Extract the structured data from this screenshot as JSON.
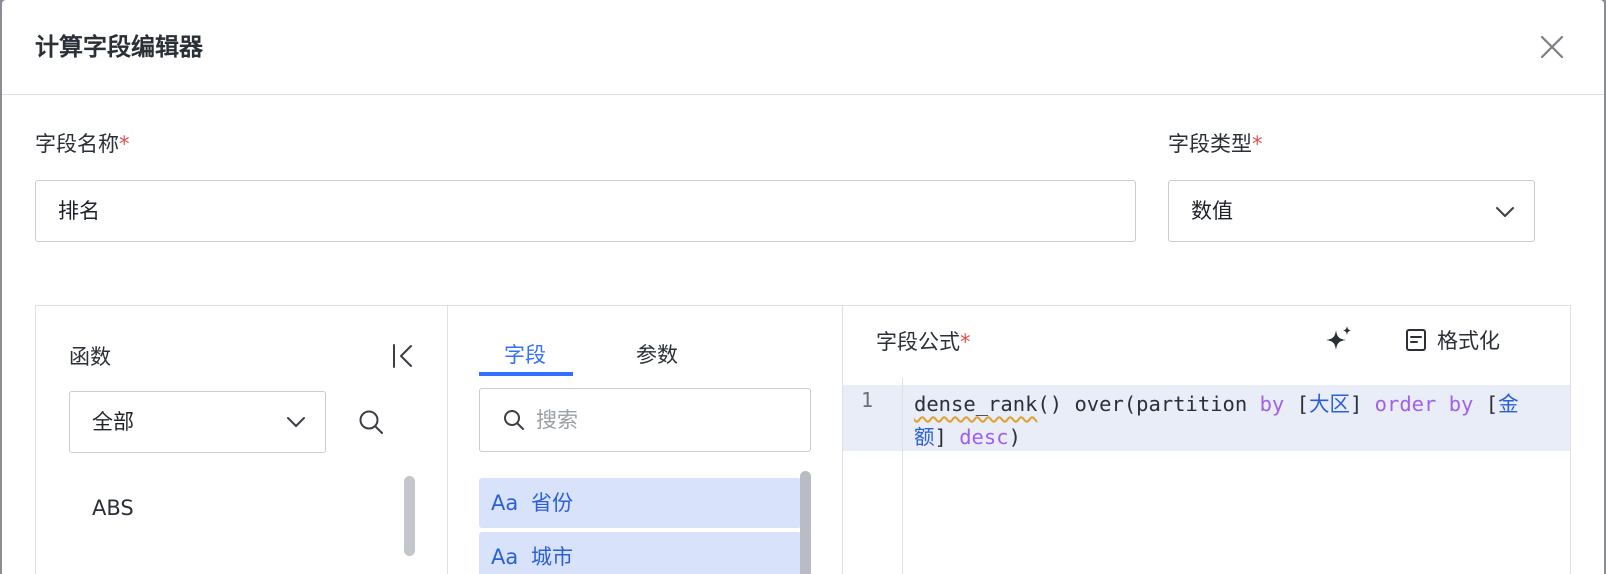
{
  "dialog": {
    "title": "计算字段编辑器"
  },
  "form": {
    "name_label": "字段名称",
    "name_value": "排名",
    "type_label": "字段类型",
    "type_value": "数值",
    "required_mark": "*"
  },
  "functions": {
    "title": "函数",
    "category_value": "全部",
    "items": [
      "ABS"
    ]
  },
  "fields_panel": {
    "tabs": [
      "字段",
      "参数"
    ],
    "active_tab": "字段",
    "search_placeholder": "搜索",
    "items": [
      {
        "type_icon": "Aa",
        "label": "省份"
      },
      {
        "type_icon": "Aa",
        "label": "城市"
      }
    ]
  },
  "formula": {
    "title": "字段公式",
    "format_label": "格式化",
    "line_number": "1",
    "code": {
      "fn": "dense_rank",
      "t1": "() over(partition ",
      "kw_by1": "by",
      "t2": " [",
      "field1": "大区",
      "t3": "] ",
      "kw_order": "order",
      "kw_by2": "by",
      "t4": " [",
      "field2": "金额",
      "t5": "] ",
      "kw_desc": "desc",
      "t6": ")"
    }
  },
  "colors": {
    "accent": "#3370ff",
    "required": "#e34d4d",
    "keyword": "#a260e8",
    "field_ref": "#2b5fd9"
  }
}
